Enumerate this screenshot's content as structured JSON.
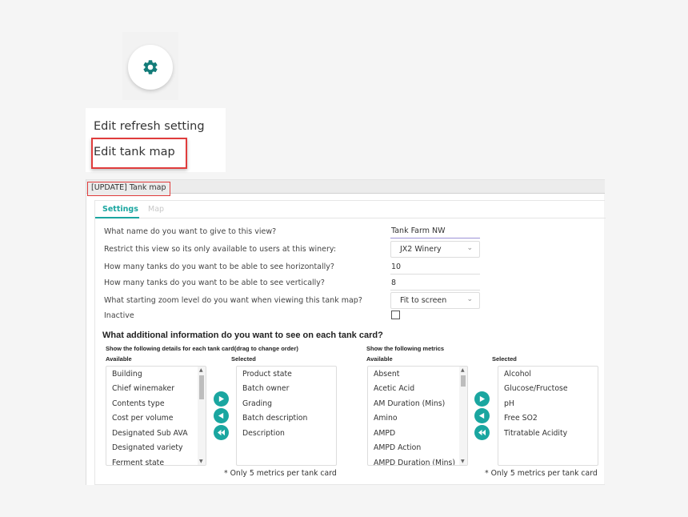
{
  "gear": {
    "icon": "gear-icon",
    "color": "#137c79"
  },
  "menu": {
    "items": [
      {
        "label": "Edit refresh setting"
      },
      {
        "label": "Edit tank map",
        "highlighted": true
      }
    ]
  },
  "dialog": {
    "title": "[UPDATE] Tank map",
    "tabs": [
      {
        "label": "Settings",
        "active": true
      },
      {
        "label": "Map",
        "active": false
      }
    ],
    "accent": "#1aa6a0",
    "questions": {
      "name": {
        "label": "What name do you want to give to this view?",
        "value": "Tank Farm NW"
      },
      "winery": {
        "label": "Restrict this view so its only available to users at this winery:",
        "value": "JX2 Winery"
      },
      "horizontal": {
        "label": "How many tanks do you want to be able to see horizontally?",
        "value": "10"
      },
      "vertical": {
        "label": "How many tanks do you want to be able to see vertically?",
        "value": "8"
      },
      "zoom": {
        "label": "What starting zoom level do you want when viewing this tank map?",
        "value": "Fit to screen"
      },
      "inactive": {
        "label": "Inactive",
        "checked": false
      }
    },
    "additional": {
      "heading": "What additional information do you want to see on each tank card?",
      "details": {
        "heading": "Show the following details for each tank card(drag to change order)",
        "available_label": "Available",
        "selected_label": "Selected",
        "available": [
          "Building",
          "Chief winemaker",
          "Contents type",
          "Cost per volume",
          "Designated Sub AVA",
          "Designated variety",
          "Ferment state"
        ],
        "selected": [
          "Product state",
          "Batch owner",
          "Grading",
          "Batch description",
          "Description"
        ],
        "note": "* Only 5 metrics per tank card"
      },
      "metrics": {
        "heading": "Show the following metrics",
        "available_label": "Available",
        "selected_label": "Selected",
        "available": [
          "Absent",
          "Acetic Acid",
          "AM Duration (Mins)",
          "Amino",
          "AMPD",
          "AMPD Action",
          "AMPD Duration (Mins)"
        ],
        "selected": [
          "Alcohol",
          "Glucose/Fructose",
          "pH",
          "Free SO2",
          "Titratable Acidity"
        ],
        "note": "* Only 5 metrics per tank card"
      }
    }
  }
}
